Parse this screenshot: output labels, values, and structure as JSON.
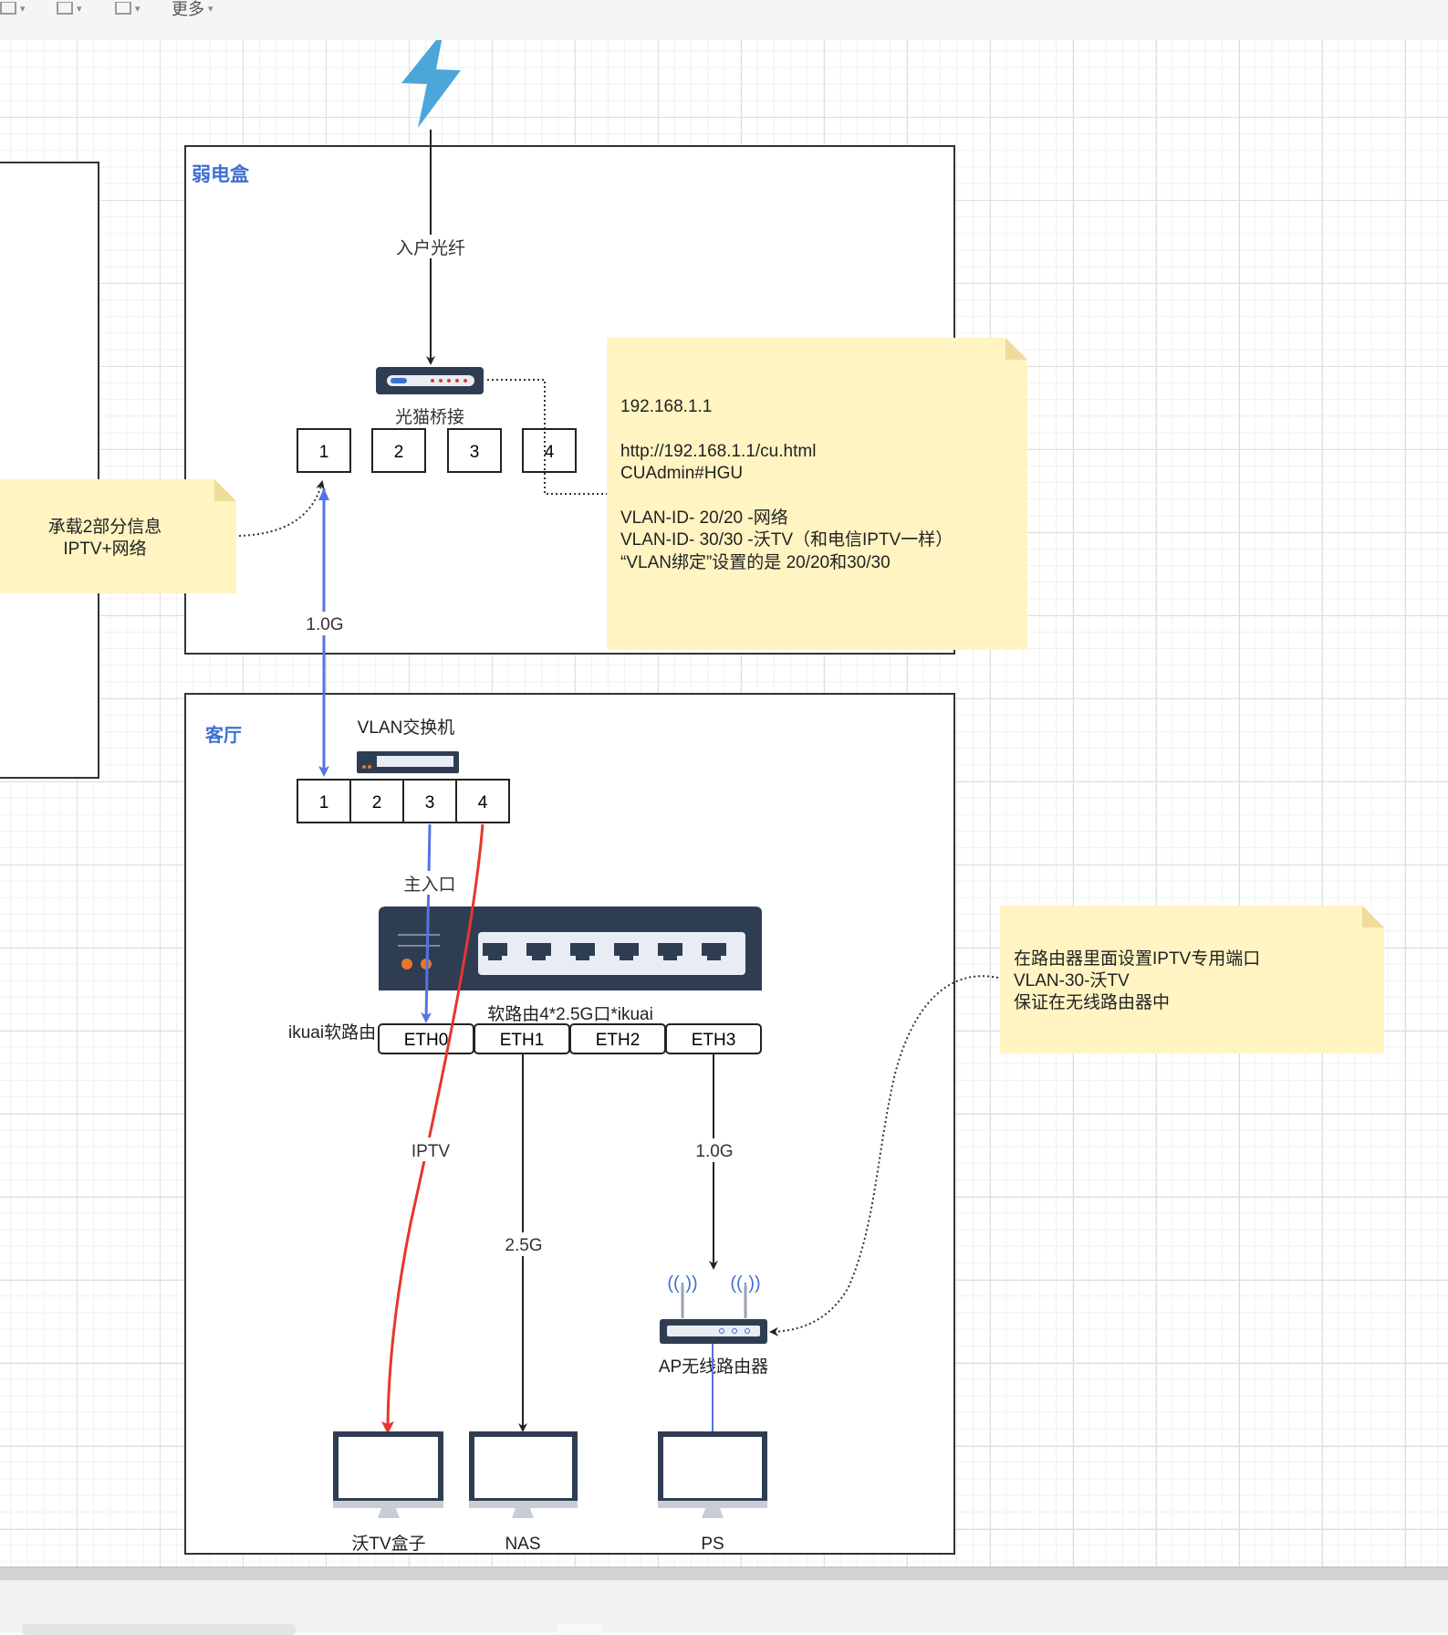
{
  "toolbar": {
    "items": [
      {
        "icon": "layers-icon",
        "label": ""
      },
      {
        "icon": "align-icon",
        "label": ""
      },
      {
        "icon": "grid-icon",
        "label": ""
      },
      {
        "icon": "",
        "label": "更多"
      }
    ]
  },
  "diagram": {
    "containers": {
      "weak_box": {
        "title": "弱电盒"
      },
      "living_room": {
        "title": "客厅"
      }
    },
    "edge_labels": {
      "fiber": "入户光纤",
      "link_1g_top": "1.0G",
      "main_entry": "主入口",
      "iptv": "IPTV",
      "nas_speed": "2.5G",
      "ap_speed": "1.0G"
    },
    "devices": {
      "modem": {
        "label": "光猫桥接",
        "ports": [
          "1",
          "2",
          "3",
          "4"
        ]
      },
      "vlan_switch": {
        "label": "VLAN交换机",
        "ports": [
          "1",
          "2",
          "3",
          "4"
        ]
      },
      "soft_router": {
        "label": "软路由4*2.5G口*ikuai",
        "side_label": "ikuai软路由",
        "ports": [
          "ETH0",
          "ETH1",
          "ETH2",
          "ETH3"
        ]
      },
      "ap_router": {
        "label": "AP无线路由器"
      },
      "tv_box": {
        "label": "沃TV盒子"
      },
      "nas": {
        "label": "NAS"
      },
      "ps": {
        "label": "PS"
      }
    },
    "notes": {
      "modem_config": {
        "lines": [
          "192.168.1.1",
          "",
          "http://192.168.1.1/cu.html",
          "CUAdmin#HGU",
          "",
          "VLAN-ID- 20/20 -网络",
          "VLAN-ID- 30/30 -沃TV（和电信IPTV一样）",
          "“VLAN绑定”设置的是 20/20和30/30"
        ]
      },
      "carry_info": {
        "lines": [
          "承载2部分信息",
          "IPTV+网络"
        ]
      },
      "router_iptv": {
        "lines": [
          "在路由器里面设置IPTV专用端口",
          "VLAN-30-沃TV",
          "保证在无线路由器中"
        ]
      }
    },
    "colors": {
      "blue_link": "#5573e4",
      "red_link": "#e8362c",
      "title_blue": "#3f6fd1",
      "note_fill": "#fff4c2",
      "device_dark": "#2e3d52",
      "bolt": "#4ba6d9"
    }
  }
}
